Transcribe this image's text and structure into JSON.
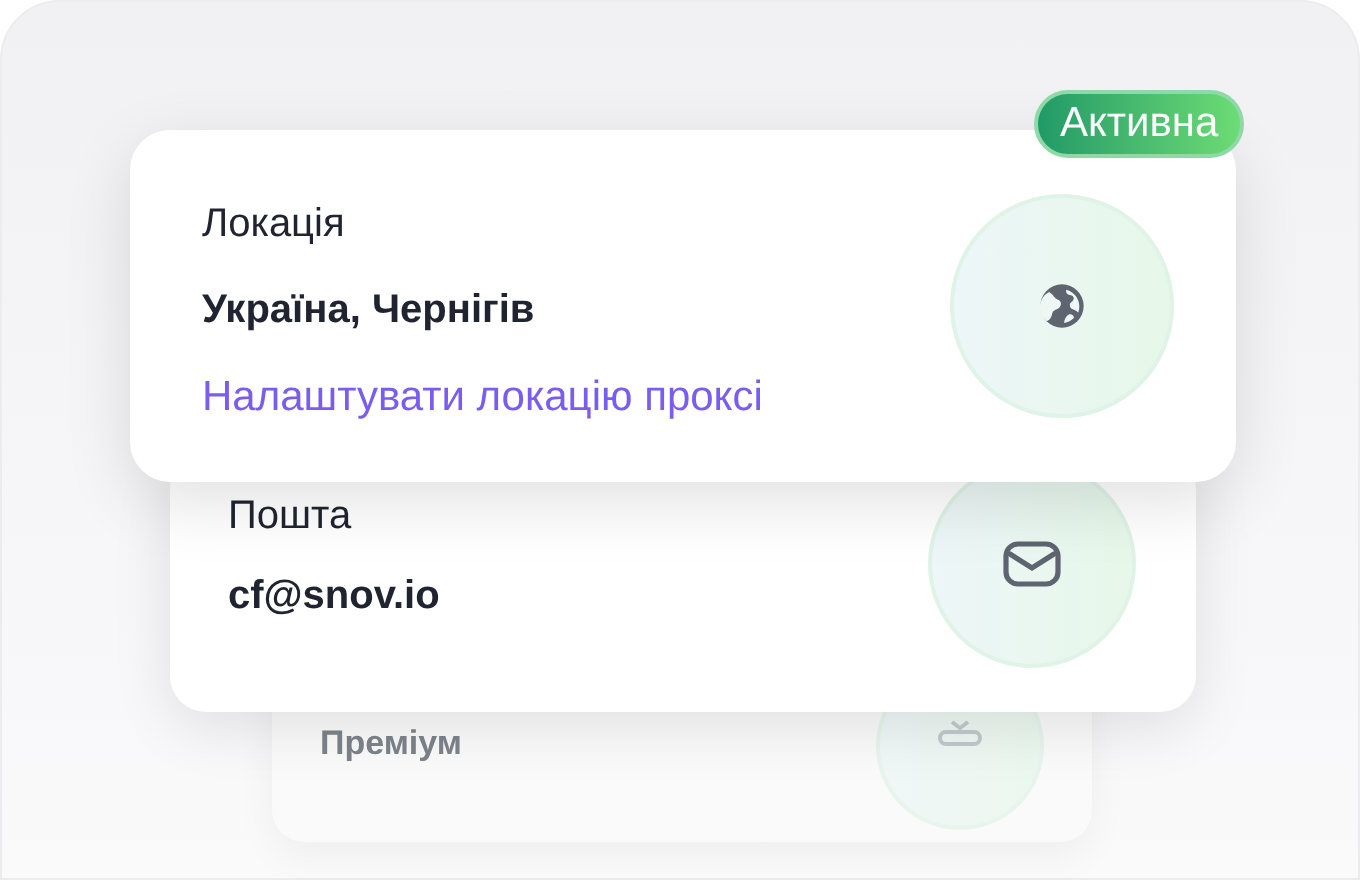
{
  "badge": {
    "label": "Активна"
  },
  "cards": [
    {
      "kind": "location",
      "label": "Локація",
      "value": "Україна, Чернігів",
      "link": "Налаштувати локацію проксі"
    },
    {
      "kind": "email",
      "label": "Пошта",
      "value": "cf@snov.io"
    },
    {
      "kind": "plan",
      "label": "Преміум"
    }
  ]
}
